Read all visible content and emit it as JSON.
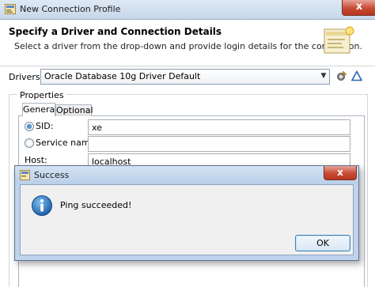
{
  "window": {
    "title": "New Connection Profile",
    "close_glyph": "x"
  },
  "header": {
    "title": "Specify a Driver and Connection Details",
    "description": "Select a driver from the drop-down and provide login details for the connection."
  },
  "drivers": {
    "label": "Drivers:",
    "selected": "Oracle Database 10g Driver Default"
  },
  "properties": {
    "label": "Properties",
    "tabs": [
      {
        "label": "General",
        "active": true
      },
      {
        "label": "Optional",
        "active": false
      }
    ],
    "sid": {
      "label": "SID:",
      "value": "xe",
      "selected": true
    },
    "service_name": {
      "label": "Service name:",
      "value": "",
      "selected": false
    },
    "host": {
      "label": "Host:",
      "value": "localhost"
    }
  },
  "dialog": {
    "title": "Success",
    "close_glyph": "x",
    "message": "Ping succeeded!",
    "ok_label": "OK"
  },
  "colors": {
    "titlebar": "#c6d6ea",
    "close_button": "#c74a34",
    "dialog_frame": "#bfd3ec",
    "info_icon": "#1e5fa8"
  }
}
